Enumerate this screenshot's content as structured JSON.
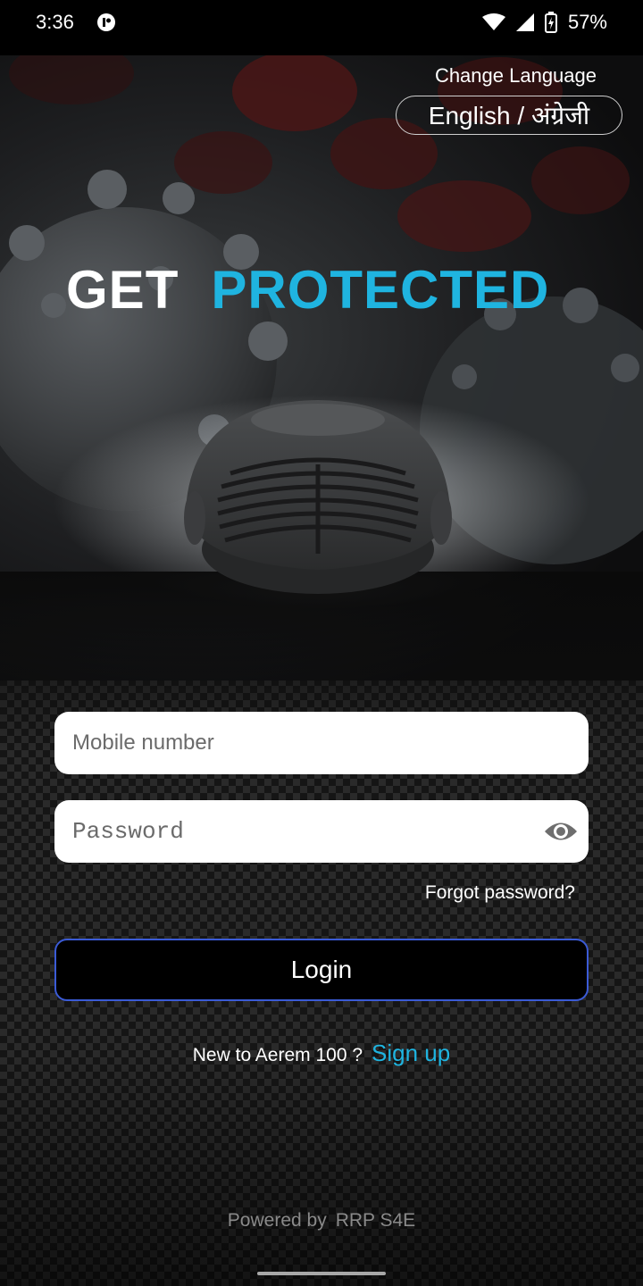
{
  "status_bar": {
    "time": "3:36",
    "battery_percent": "57%",
    "icons": [
      "app-notification-icon",
      "wifi-icon",
      "cell-signal-icon",
      "battery-charging-icon"
    ]
  },
  "language": {
    "title": "Change Language",
    "current": "English / अंग्रेजी"
  },
  "headline": {
    "word1": "GET",
    "word2": "PROTECTED",
    "accent_color": "#1fb4e0"
  },
  "form": {
    "mobile_placeholder": "Mobile number",
    "password_placeholder": "Password",
    "forgot_label": "Forgot password?",
    "login_label": "Login"
  },
  "signup": {
    "prefix": "New to Aerem 100 ?",
    "link": "Sign up"
  },
  "footer": {
    "prefix": "Powered by",
    "brand": "RRP S4E"
  }
}
